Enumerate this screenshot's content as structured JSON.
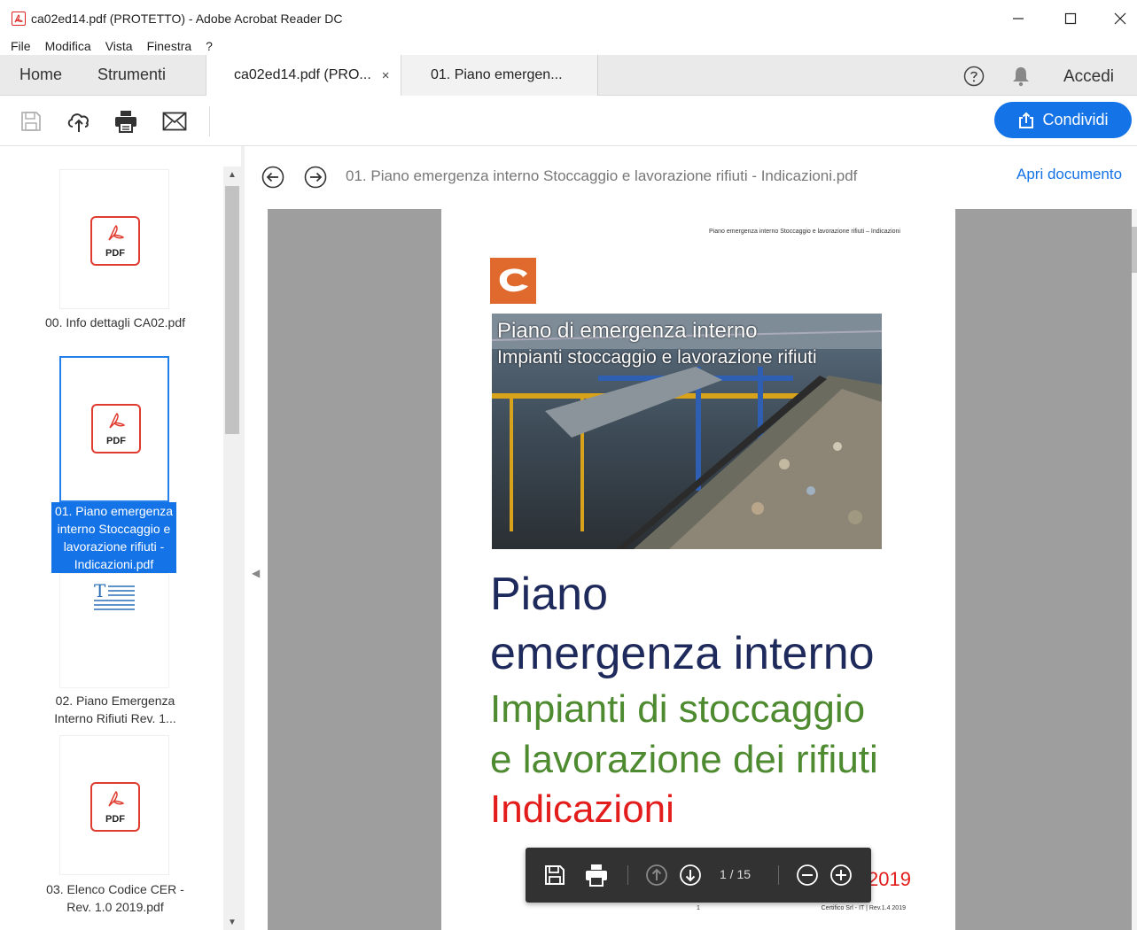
{
  "window": {
    "title": "ca02ed14.pdf (PROTETTO) - Adobe Acrobat Reader DC"
  },
  "menu": [
    "File",
    "Modifica",
    "Vista",
    "Finestra",
    "?"
  ],
  "tabs": {
    "home": "Home",
    "tools": "Strumenti",
    "docs": [
      {
        "label": "ca02ed14.pdf (PRO...",
        "active": true
      },
      {
        "label": "01. Piano emergen...",
        "active": false
      }
    ],
    "close_glyph": "×",
    "signin": "Accedi"
  },
  "toolbar": {
    "share_label": "Condividi"
  },
  "attachments": [
    {
      "label": "00. Info dettagli CA02.pdf",
      "type": "pdf",
      "badge": "PDF"
    },
    {
      "label": "01. Piano emergenza interno Stoccaggio e lavorazione rifiuti - Indicazioni.pdf",
      "type": "pdf",
      "badge": "PDF",
      "selected": true
    },
    {
      "label": "02. Piano Emergenza Interno Rifiuti Rev. 1...",
      "type": "text"
    },
    {
      "label": "03. Elenco Codice CER - Rev. 1.0 2019.pdf",
      "type": "pdf",
      "badge": "PDF"
    }
  ],
  "attachment_labels_wrapped": {
    "a0": "00. Info dettagli CA02.pdf",
    "a1_l1": "01. Piano emergenza",
    "a1_l2": "interno Stoccaggio e",
    "a1_l3": "lavorazione rifiuti -",
    "a1_l4": "Indicazioni.pdf",
    "a2_l1": "02. Piano Emergenza",
    "a2_l2": "Interno Rifiuti Rev. 1...",
    "a3_l1": "03. Elenco Codice CER -",
    "a3_l2": "Rev. 1.0 2019.pdf"
  },
  "docnav": {
    "filename": "01. Piano emergenza interno Stoccaggio e lavorazione rifiuti - Indicazioni.pdf",
    "open_label": "Apri documento"
  },
  "page": {
    "running_head": "Piano emergenza interno Stoccaggio e lavorazione rifiuti – Indicazioni",
    "photo_caption_1": "Piano di emergenza interno",
    "photo_caption_2": "Impianti stoccaggio e lavorazione rifiuti",
    "title_1": "Piano",
    "title_2": "emergenza interno",
    "subtitle_1": "Impianti di stoccaggio",
    "subtitle_2": "e lavorazione dei rifiuti",
    "subtitle_3": "Indicazioni",
    "year": "2019",
    "page_number": "1",
    "footer": "Certifico Srl - IT | Rev.1.4 2019"
  },
  "floatbar": {
    "current_page": "1",
    "total_pages": "15",
    "page_display": "1 / 15"
  },
  "colors": {
    "accent": "#1473e6",
    "pdf_red": "#e03b2f",
    "title_navy": "#1f2a5c",
    "subtitle_green": "#4e8a2f",
    "highlight_red": "#e31c1c",
    "logo_orange": "#e06a2d"
  }
}
